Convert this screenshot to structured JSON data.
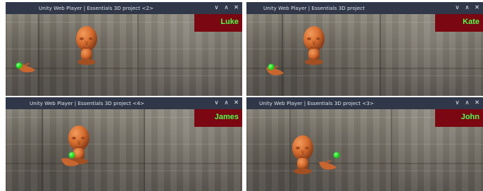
{
  "windows": [
    {
      "title": "Unity Web Player | Essentials 3D project <2>",
      "player_name": "Luke"
    },
    {
      "title": "Unity Web Player | Essentials 3D project",
      "player_name": "Kate"
    },
    {
      "title": "Unity Web Player | Essentials 3D project <4>",
      "player_name": "James"
    },
    {
      "title": "Unity Web Player | Essentials 3D project <3>",
      "player_name": "John"
    }
  ],
  "controls": {
    "minimize": "∨",
    "maximize": "∧",
    "close": "✕"
  },
  "colors": {
    "titlebar": "#2f3748",
    "name_panel": "#7a0711",
    "name_text": "#4cff4c",
    "avatar_skin": "#d66a2e",
    "marker": "#18e018"
  },
  "icons": {
    "avatar": "avatar-head-icon",
    "hand": "hand-icon",
    "marker": "green-dot-icon"
  }
}
